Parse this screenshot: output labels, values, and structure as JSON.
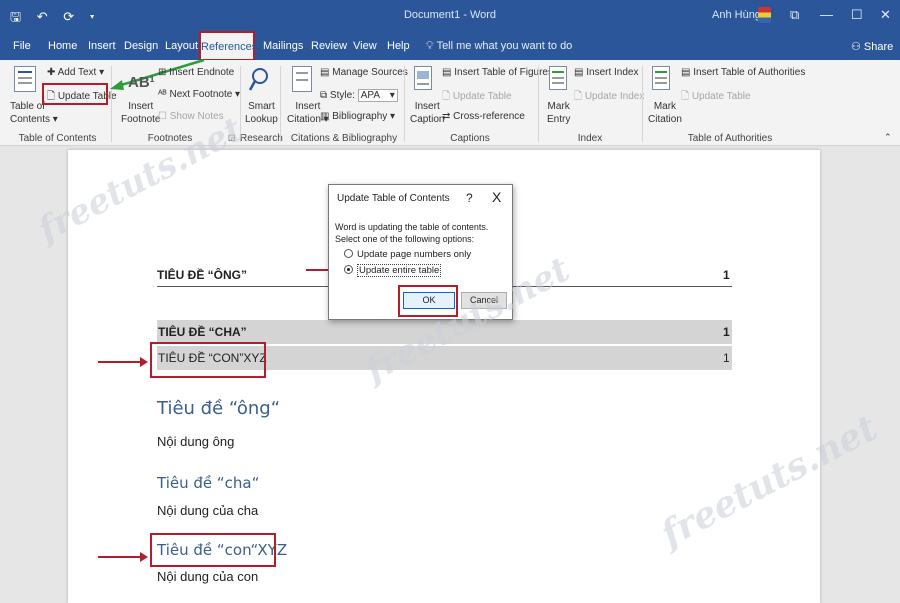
{
  "window": {
    "title": "Document1 - Word",
    "user": "Anh Hùng",
    "quick_access": "🖫 ↶ ⟳ ▾",
    "controls": [
      "⧉",
      "—",
      "☐",
      "✕"
    ]
  },
  "menu": {
    "tabs": [
      "File",
      "Home",
      "Insert",
      "Design",
      "Layout",
      "References",
      "Mailings",
      "Review",
      "View",
      "Help"
    ],
    "tell_me": "Tell me what you want to do",
    "share": "Share"
  },
  "ribbon": {
    "toc": {
      "table_of_contents": [
        "Table of",
        "Contents"
      ],
      "add_text": "Add Text",
      "update_table": "Update Table",
      "group_label": "Table of Contents"
    },
    "footnotes": {
      "insert_footnote": [
        "Insert",
        "Footnote"
      ],
      "insert_endnote": "Insert Endnote",
      "next_footnote": "Next Footnote",
      "show_notes": "Show Notes",
      "group_label": "Footnotes"
    },
    "research": {
      "smart_lookup": [
        "Smart",
        "Lookup"
      ],
      "group_label": "Research"
    },
    "citations": {
      "insert_citation": [
        "Insert",
        "Citation"
      ],
      "manage_sources": "Manage Sources",
      "style_label": "Style:",
      "style_value": "APA",
      "bibliography": "Bibliography",
      "group_label": "Citations & Bibliography"
    },
    "captions": {
      "insert_caption": [
        "Insert",
        "Caption"
      ],
      "insert_table_of_figures": "Insert Table of Figures",
      "update_table": "Update Table",
      "cross_reference": "Cross-reference",
      "group_label": "Captions"
    },
    "index": {
      "mark_entry": [
        "Mark",
        "Entry"
      ],
      "insert_index": "Insert Index",
      "update_index": "Update Index",
      "group_label": "Index"
    },
    "authorities": {
      "mark_citation": [
        "Mark",
        "Citation"
      ],
      "insert_table_of_authorities": "Insert Table of Authorities",
      "update_table": "Update Table",
      "group_label": "Table of Authorities"
    }
  },
  "document": {
    "toc": [
      {
        "text": "TIÊU ĐỀ “ÔNG”",
        "page": "1"
      },
      {
        "text": "TIÊU ĐỀ “CHA”",
        "page": "1"
      },
      {
        "text": "TIÊU ĐỀ “CON”XYZ",
        "page": "1"
      }
    ],
    "heading1": "Tiêu đề “ông“",
    "body1": "Nội dung ông",
    "heading2": "Tiêu đề “cha“",
    "body2": "Nội dung của cha",
    "heading3": "Tiêu đề “con“XYZ",
    "body3": "Nội dung của con"
  },
  "dialog": {
    "title": "Update Table of Contents",
    "help": "?",
    "close": "X",
    "message": "Word is updating the table of contents.  Select one of the following options:",
    "options": [
      "Update page numbers only",
      "Update entire table"
    ],
    "selected_option": "Update entire table",
    "ok": "OK",
    "cancel": "Cancel"
  },
  "watermark": "freetuts.net",
  "colors": {
    "brand": "#2b579a",
    "annotation": "#b51d2a",
    "pointer": "#2e9c3a"
  }
}
